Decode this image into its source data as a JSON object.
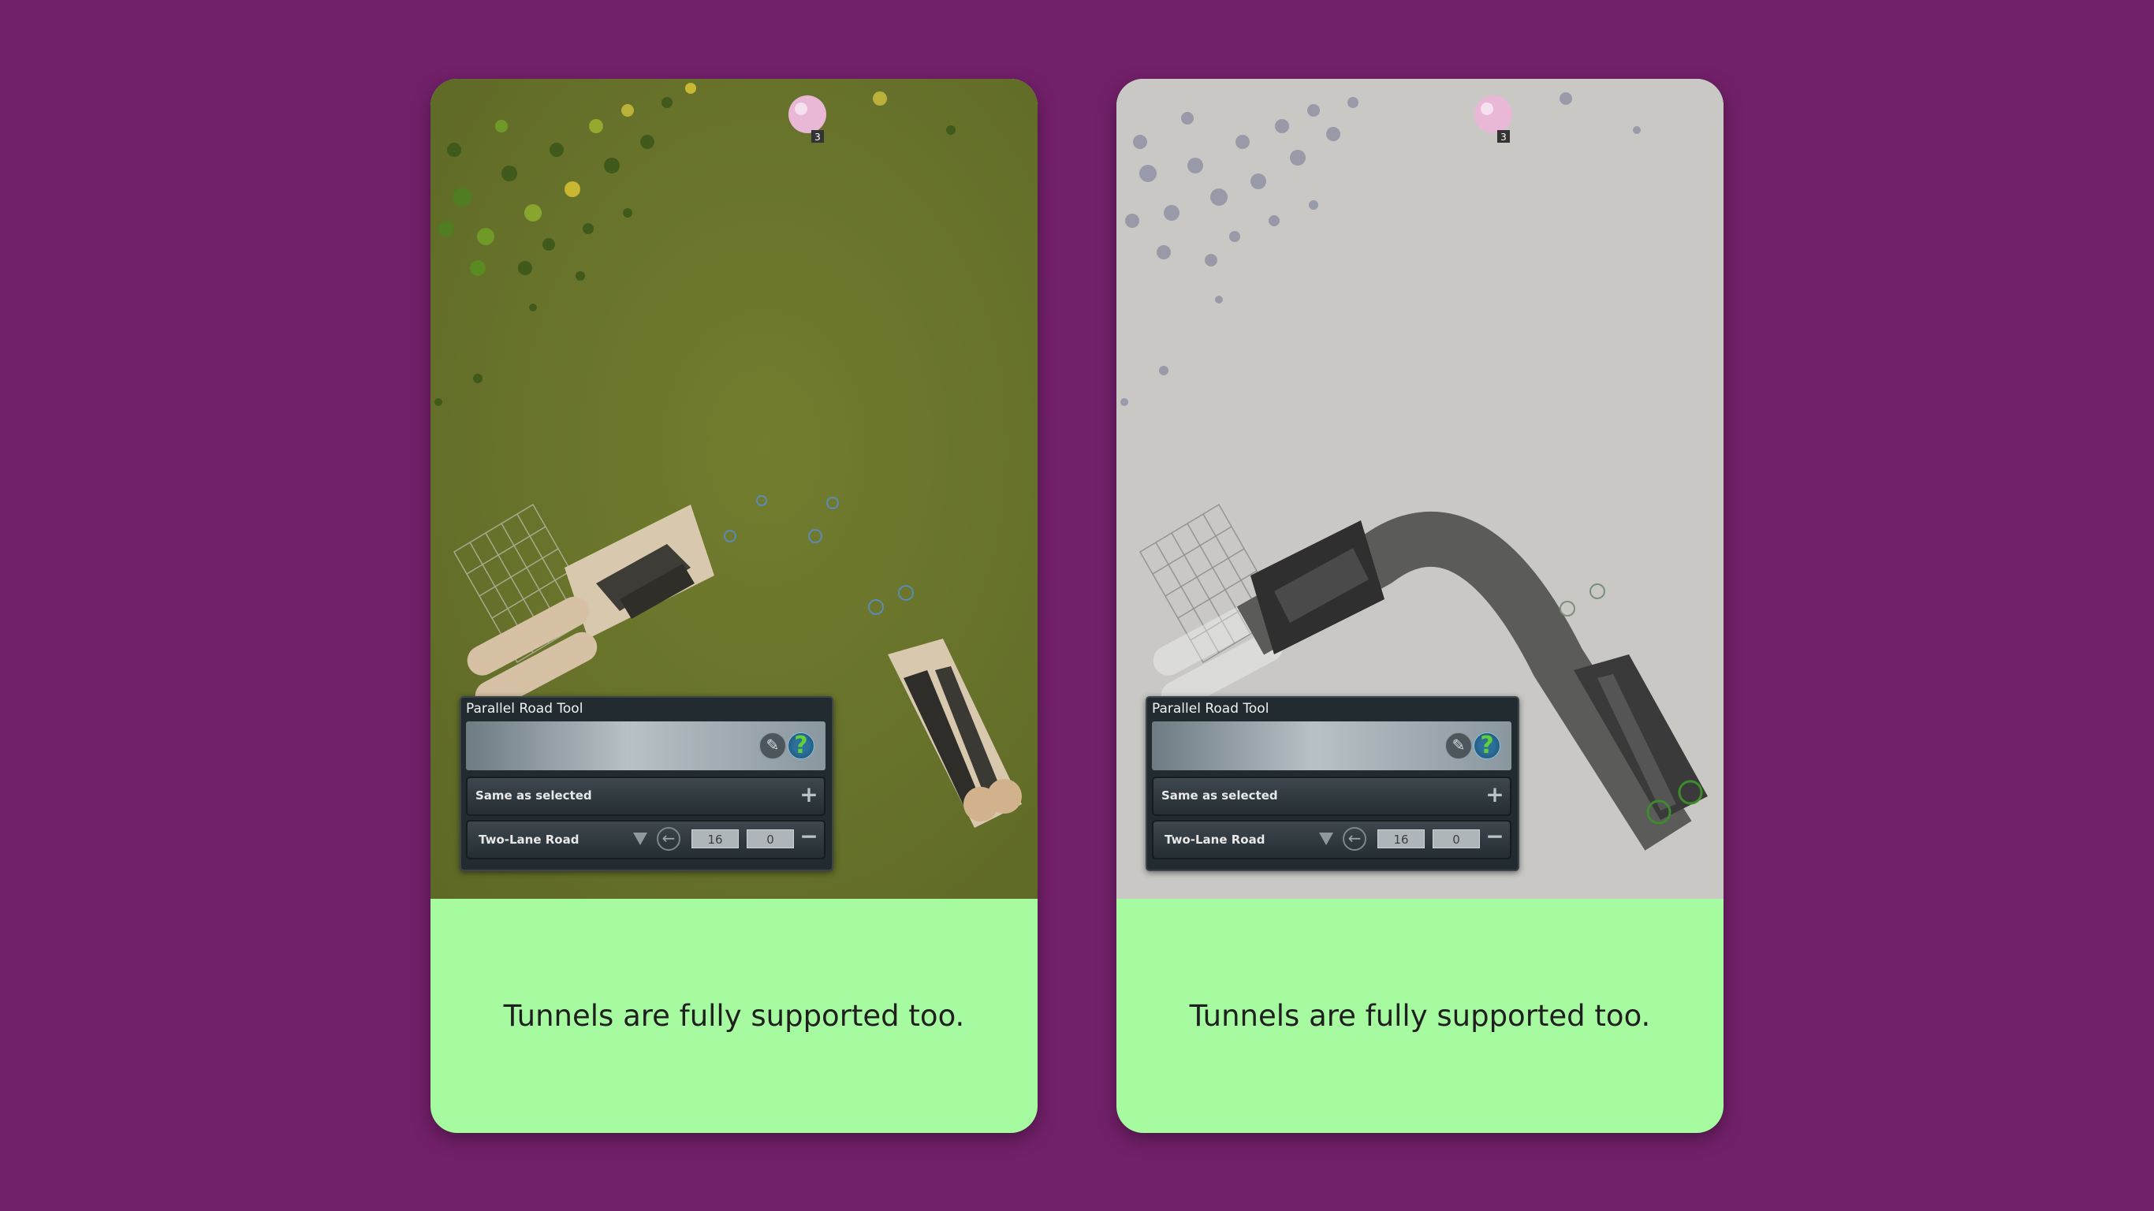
{
  "cards": [
    {
      "caption": "Tunnels are fully supported too.",
      "scene": "terrain",
      "panel": {
        "title": "Parallel Road Tool",
        "preset_label": "Same as selected",
        "road_label": "Two-Lane Road",
        "offset_value": "16",
        "elevation_value": "0",
        "plus_symbol": "+",
        "minus_symbol": "−",
        "help_symbol": "?",
        "brush_symbol": "✎",
        "back_symbol": "←"
      },
      "badge_count": "3"
    },
    {
      "caption": "Tunnels are fully supported too.",
      "scene": "underground",
      "panel": {
        "title": "Parallel Road Tool",
        "preset_label": "Same as selected",
        "road_label": "Two-Lane Road",
        "offset_value": "16",
        "elevation_value": "0",
        "plus_symbol": "+",
        "minus_symbol": "−",
        "help_symbol": "?",
        "brush_symbol": "✎",
        "back_symbol": "←"
      },
      "badge_count": "3"
    }
  ],
  "colors": {
    "page_background": "#73206a",
    "caption_background": "#a6fa9f",
    "terrain": "#6f7a2f",
    "underground": "#c9c8c5"
  }
}
